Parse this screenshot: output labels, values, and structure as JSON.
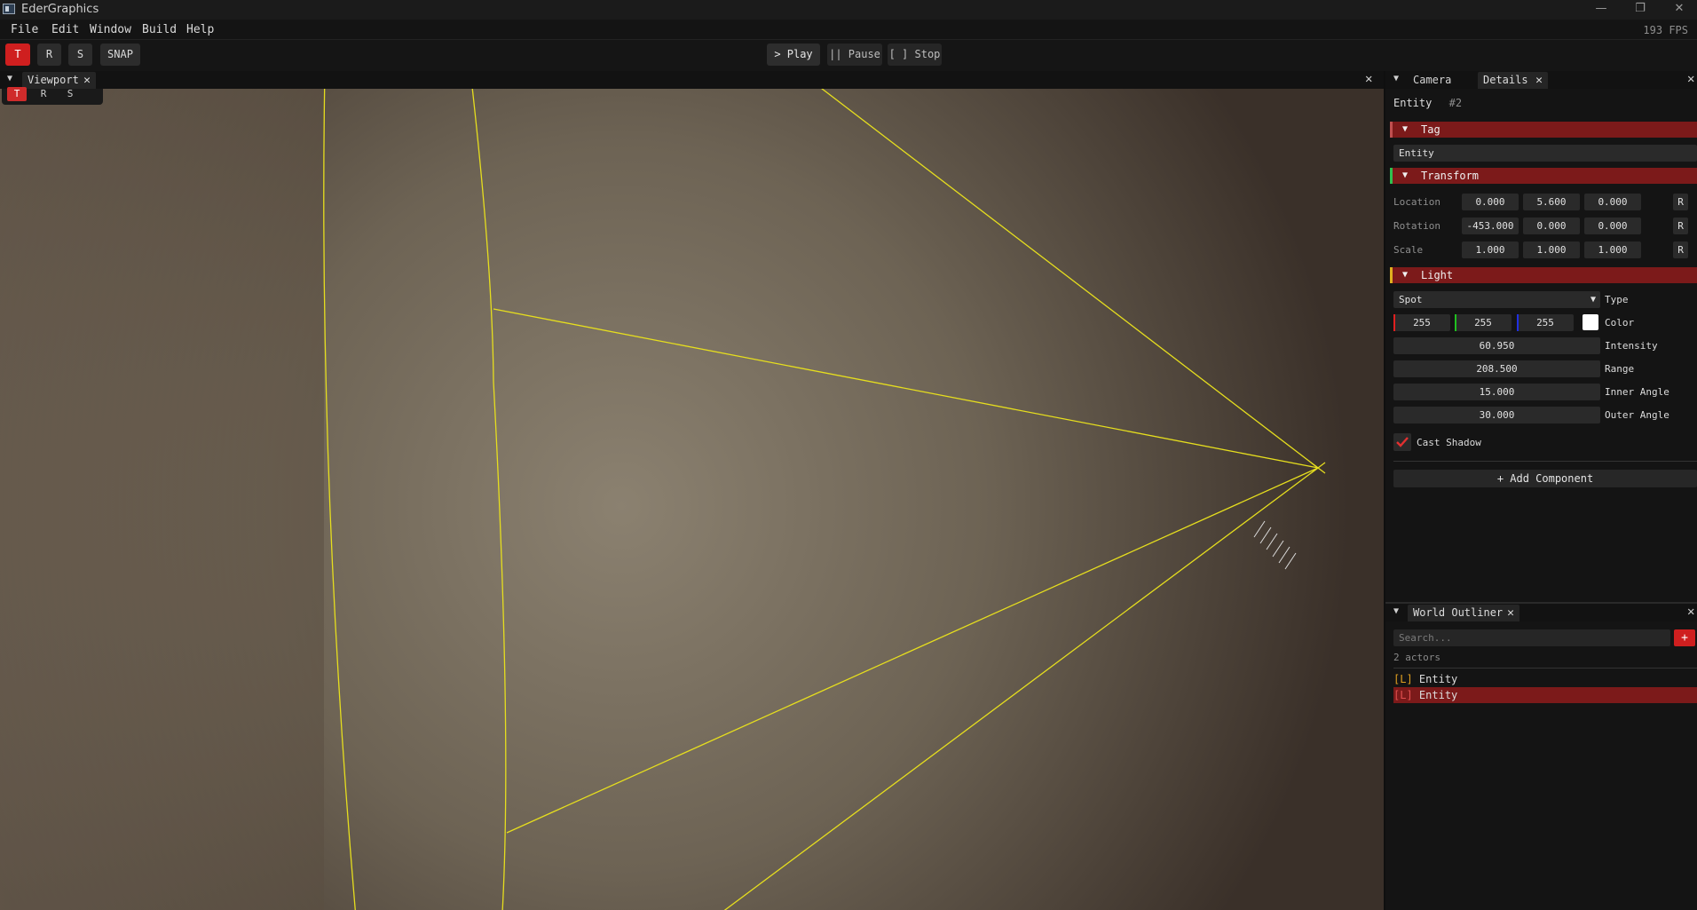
{
  "window": {
    "title": "EderGraphics",
    "min_glyph": "—",
    "restore_glyph": "❐",
    "close_glyph": "✕"
  },
  "menubar": {
    "items": [
      "File",
      "Edit",
      "Window",
      "Build",
      "Help"
    ],
    "fps": "193 FPS"
  },
  "toolbar": {
    "translate": "T",
    "rotate": "R",
    "scale": "S",
    "snap": "SNAP",
    "play": "> Play",
    "pause": "|| Pause",
    "stop": "[ ] Stop",
    "active_tool": "T"
  },
  "viewport": {
    "tab_label": "Viewport",
    "mini_tools": [
      "T",
      "R",
      "S"
    ],
    "background_color": "#3a3029",
    "light_color": "#8a7f6c",
    "gizmo_color": "#e8e020"
  },
  "details": {
    "tabs": [
      "Camera",
      "Details"
    ],
    "active_tab": "Details",
    "entity_label": "Entity",
    "entity_id": "#2",
    "tag_section": "Tag",
    "tag_value": "Entity",
    "transform_section": "Transform",
    "location_label": "Location",
    "location": [
      "0.000",
      "5.600",
      "0.000"
    ],
    "rotation_label": "Rotation",
    "rotation": [
      "-453.000",
      "0.000",
      "0.000"
    ],
    "scale_label": "Scale",
    "scale": [
      "1.000",
      "1.000",
      "1.000"
    ],
    "reset_label": "R",
    "light_section": "Light",
    "light_type": "Spot",
    "type_label": "Type",
    "color_rgb": [
      "255",
      "255",
      "255"
    ],
    "color_label": "Color",
    "intensity": "60.950",
    "intensity_label": "Intensity",
    "range": "208.500",
    "range_label": "Range",
    "inner_angle": "15.000",
    "inner_angle_label": "Inner Angle",
    "outer_angle": "30.000",
    "outer_angle_label": "Outer Angle",
    "cast_shadow_label": "Cast Shadow",
    "cast_shadow": true,
    "add_component": "+ Add Component",
    "section_colors": {
      "tag": "#c05050",
      "transform": "#2fc050",
      "light": "#e0b020"
    }
  },
  "outliner": {
    "tab_label": "World Outliner",
    "search_placeholder": "Search...",
    "add_label": "+",
    "actor_count": "2 actors",
    "actors": [
      {
        "tag": "[L]",
        "name": "Entity",
        "selected": false
      },
      {
        "tag": "[L]",
        "name": "Entity",
        "selected": true
      }
    ]
  }
}
